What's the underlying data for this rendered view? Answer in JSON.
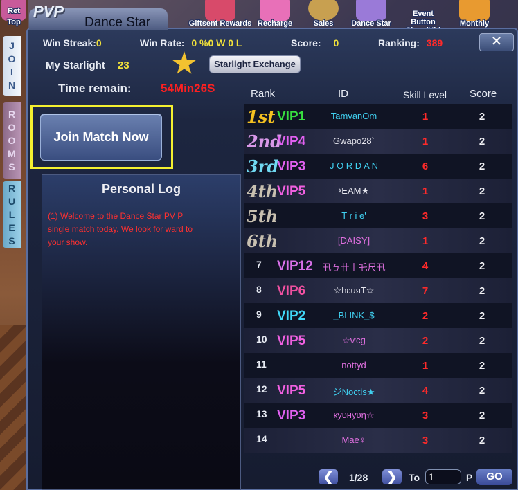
{
  "top_menu": [
    {
      "label": "Ret",
      "sub": "Top",
      "color": "#c85a9a"
    },
    {
      "label": "Giftsent Rewards",
      "color": "#d84a6a"
    },
    {
      "label": "Recharge",
      "color": "#e870b8"
    },
    {
      "label": "Sales",
      "color": "#c8a050"
    },
    {
      "label": "Dance Star",
      "color": "#9a7ad8"
    },
    {
      "label": "Event Button Show/Hid",
      "color": "#7a9ae0"
    },
    {
      "label": "Monthly",
      "color": "#e89a30"
    }
  ],
  "window": {
    "logo": "PVP",
    "title": "Dance Star",
    "close": "✕"
  },
  "side_tabs": {
    "join": [
      "J",
      "O",
      "I",
      "N"
    ],
    "rooms": [
      "R",
      "O",
      "O",
      "M",
      "S"
    ],
    "rules": [
      "R",
      "U",
      "L",
      "E",
      "S"
    ]
  },
  "stats": {
    "win_streak_label": "Win Streak:",
    "win_streak": "0",
    "win_rate_label": "Win Rate:",
    "win_rate": "0 %0 W 0 L",
    "score_label": "Score:",
    "score": "0",
    "ranking_label": "Ranking:",
    "ranking": "389",
    "starlight_label": "My Starlight",
    "starlight": "23",
    "exchange_button": "Starlight Exchange"
  },
  "time": {
    "label": "Time remain:",
    "value": "54Min26S"
  },
  "join_button": "Join Match Now",
  "personal_log": {
    "title": "Personal Log",
    "text": "(1) Welcome to the Dance Star PV P single match today. We look for ward to your show."
  },
  "table": {
    "headers": {
      "rank": "Rank",
      "id": "ID",
      "skill": "Skill Level",
      "score": "Score"
    },
    "rows": [
      {
        "rank": "1st",
        "vip": "VIP1",
        "vip_color": "#38e040",
        "rank_color": "#f4c020",
        "id": "TamvanOm",
        "id_color": "#40d0f0",
        "skill": "1",
        "score": "2"
      },
      {
        "rank": "2nd",
        "vip": "VIP4",
        "vip_color": "#e060f0",
        "rank_color": "#d898e8",
        "id": "Gwapo28`",
        "id_color": "#e8e8f0",
        "skill": "1",
        "score": "2"
      },
      {
        "rank": "3rd",
        "vip": "VIP3",
        "vip_color": "#e060f0",
        "rank_color": "#70d8f0",
        "id": "J O R D A N",
        "id_color": "#40d0f0",
        "skill": "6",
        "score": "2"
      },
      {
        "rank": "4th",
        "vip": "VIP5",
        "vip_color": "#f060e0",
        "rank_color": "#c8c0b0",
        "id": "ᵡEAM★",
        "id_color": "#e8e8f0",
        "skill": "1",
        "score": "2"
      },
      {
        "rank": "5th",
        "vip": "",
        "vip_color": "#ffffff",
        "rank_color": "#c8c0b0",
        "id": "T r i e'",
        "id_color": "#40d0f0",
        "skill": "3",
        "score": "2"
      },
      {
        "rank": "6th",
        "vip": "",
        "vip_color": "#ffffff",
        "rank_color": "#c8c0b0",
        "id": "[DAISY]",
        "id_color": "#e070e0",
        "skill": "1",
        "score": "2"
      },
      {
        "rank": "7",
        "vip": "VIP12",
        "vip_color": "#d870e8",
        "rank_color": "#e8ecf4",
        "id": "卂ㄎ卄丨乇尺卂",
        "id_color": "#e070e0",
        "skill": "4",
        "score": "2"
      },
      {
        "rank": "8",
        "vip": "VIP6",
        "vip_color": "#f050a0",
        "rank_color": "#e8ecf4",
        "id": "☆hɛuяT☆",
        "id_color": "#e8e8f0",
        "skill": "7",
        "score": "2"
      },
      {
        "rank": "9",
        "vip": "VIP2",
        "vip_color": "#40d8f8",
        "rank_color": "#e8ecf4",
        "id": "_BLINK_$",
        "id_color": "#40d0f0",
        "skill": "2",
        "score": "2"
      },
      {
        "rank": "10",
        "vip": "VIP5",
        "vip_color": "#f060e0",
        "rank_color": "#e8ecf4",
        "id": "☆ѵєg",
        "id_color": "#e070e0",
        "skill": "2",
        "score": "2"
      },
      {
        "rank": "11",
        "vip": "",
        "vip_color": "#ffffff",
        "rank_color": "#e8ecf4",
        "id": "nottyd",
        "id_color": "#e070e0",
        "skill": "1",
        "score": "2"
      },
      {
        "rank": "12",
        "vip": "VIP5",
        "vip_color": "#f060e0",
        "rank_color": "#e8ecf4",
        "id": "ジNoctis★",
        "id_color": "#40d0f0",
        "skill": "4",
        "score": "2"
      },
      {
        "rank": "13",
        "vip": "VIP3",
        "vip_color": "#e060f0",
        "rank_color": "#e8ecf4",
        "id": "кyυнyυη☆",
        "id_color": "#e070e0",
        "skill": "3",
        "score": "2"
      },
      {
        "rank": "14",
        "vip": "",
        "vip_color": "#ffffff",
        "rank_color": "#e8ecf4",
        "id": "Mae♀",
        "id_color": "#e070e0",
        "skill": "3",
        "score": "2"
      }
    ]
  },
  "pager": {
    "prev": "❮",
    "next": "❯",
    "page": "1/28",
    "to_label": "To",
    "input_value": "1",
    "p_label": "P",
    "go": "GO"
  }
}
